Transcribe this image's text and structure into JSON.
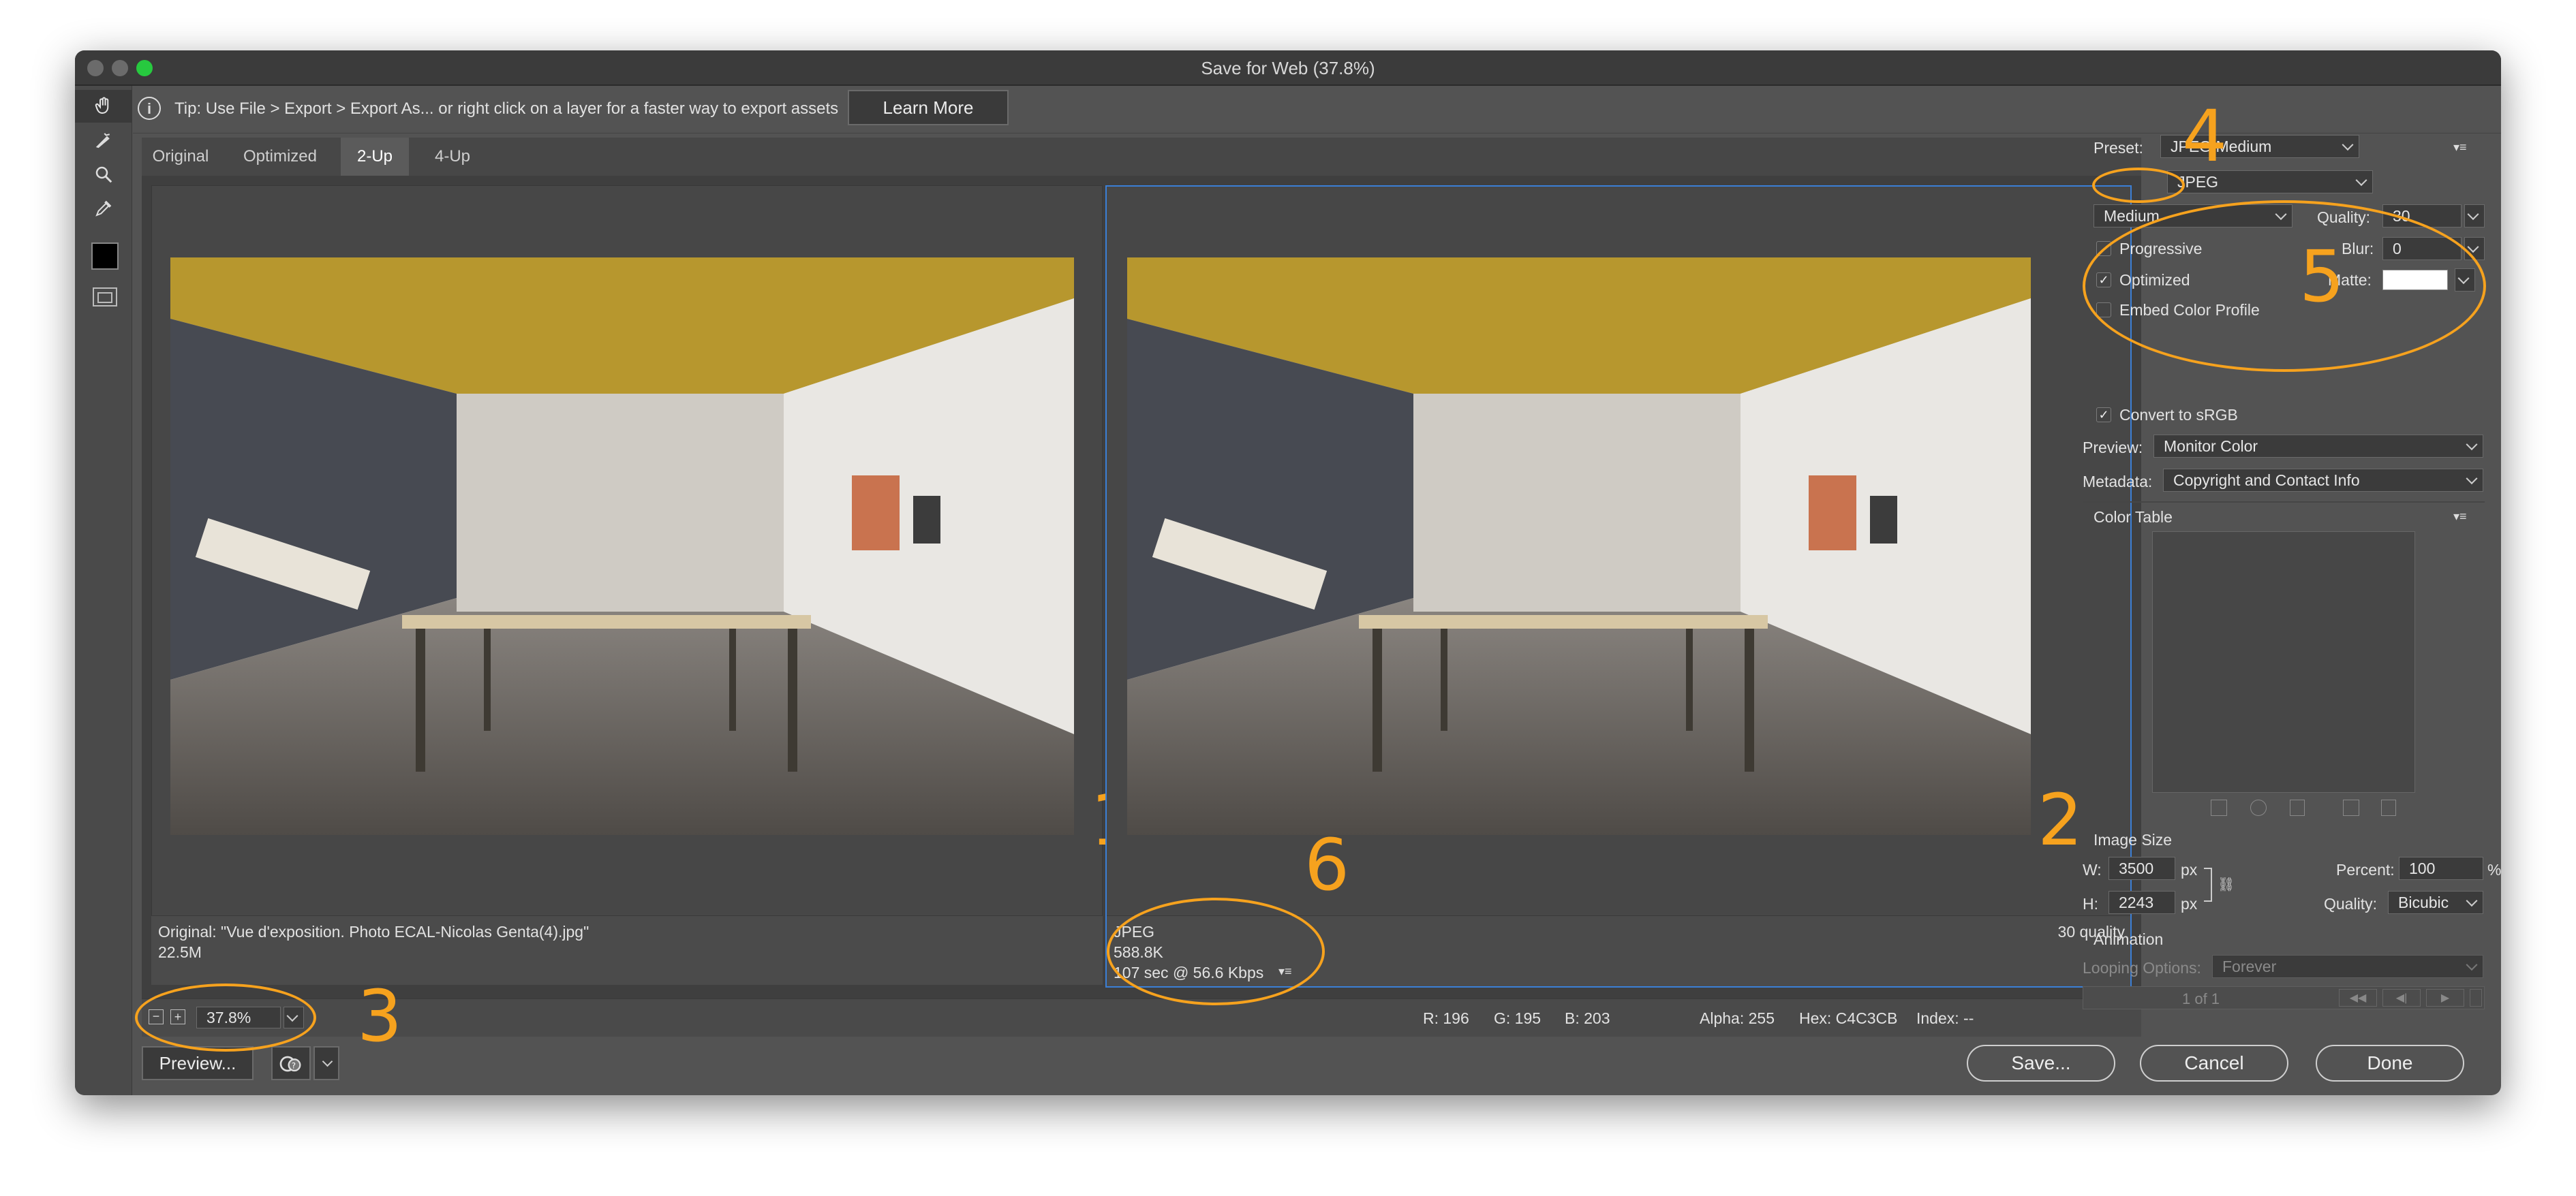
{
  "window": {
    "title": "Save for Web (37.8%)"
  },
  "tipbar": {
    "text": "Tip: Use File > Export > Export As...  or right click on a layer for a faster way to export assets",
    "learn_more": "Learn More"
  },
  "tabs": [
    "Original",
    "Optimized",
    "2-Up",
    "4-Up"
  ],
  "active_tab": "2-Up",
  "pane_left": {
    "info_line1": "Original: \"Vue d'exposition. Photo ECAL-Nicolas Genta(4).jpg\"",
    "info_line2": "22.5M",
    "marker": "1"
  },
  "pane_right": {
    "format": "JPEG",
    "size": "588.8K",
    "time": "107 sec @ 56.6 Kbps",
    "quality": "30 quality",
    "marker": "2"
  },
  "bottom": {
    "zoom": "37.8%",
    "r": "R: 196",
    "g": "G: 195",
    "b": "B: 203",
    "alpha": "Alpha: 255",
    "hex": "Hex: C4C3CB",
    "index": "Index: --"
  },
  "footer": {
    "preview": "Preview...",
    "save": "Save...",
    "cancel": "Cancel",
    "done": "Done"
  },
  "settings": {
    "preset_label": "Preset:",
    "preset_value": "JPEG Medium",
    "format_value": "JPEG",
    "quality_level": "Medium",
    "quality_label": "Quality:",
    "quality_value": "30",
    "progressive": "Progressive",
    "blur_label": "Blur:",
    "blur_value": "0",
    "optimized": "Optimized",
    "matte_label": "Matte:",
    "embed": "Embed Color Profile",
    "convert": "Convert to sRGB",
    "preview_label": "Preview:",
    "preview_value": "Monitor Color",
    "metadata_label": "Metadata:",
    "metadata_value": "Copyright and Contact Info",
    "color_table": "Color Table",
    "image_size": "Image Size",
    "w_label": "W:",
    "w_value": "3500",
    "h_label": "H:",
    "h_value": "2243",
    "px": "px",
    "percent_label": "Percent:",
    "percent_value": "100",
    "percent_unit": "%",
    "resample_label": "Quality:",
    "resample_value": "Bicubic",
    "animation": "Animation",
    "looping_label": "Looping Options:",
    "looping_value": "Forever",
    "frame_counter": "1 of 1"
  },
  "annotations": [
    "3",
    "4",
    "5",
    "6"
  ]
}
